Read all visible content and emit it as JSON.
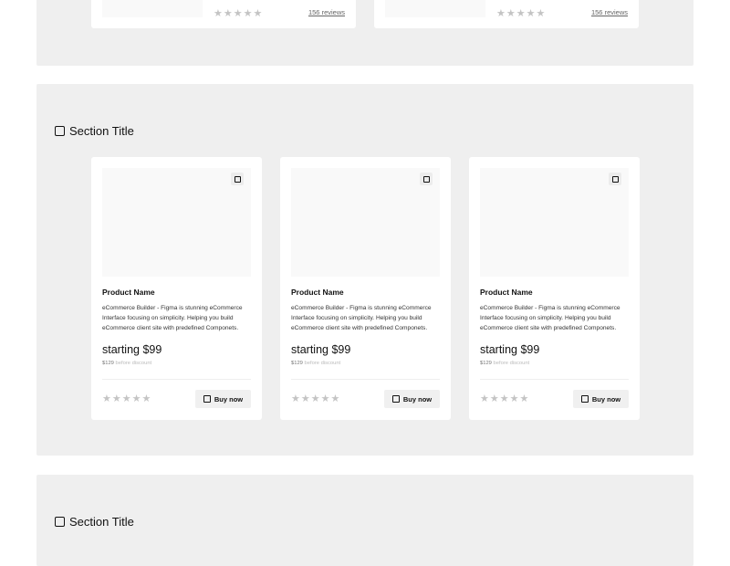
{
  "top_section": {
    "cards": [
      {
        "stars": "★★★★★",
        "reviews": "156 reviews"
      },
      {
        "stars": "★★★★★",
        "reviews": "156 reviews"
      }
    ]
  },
  "middle_section": {
    "title": "Section Title",
    "products": [
      {
        "name": "Product Name",
        "description": "eCommerce Builder - Figma is stunning eCommerce Interface focusing on simplicity. Helping you build eCommerce client site with predefined Componets.",
        "price": "starting $99",
        "old_price": "$129",
        "old_price_note": "before discount",
        "stars": "★★★★★",
        "buy_label": "Buy now"
      },
      {
        "name": "Product Name",
        "description": "eCommerce Builder - Figma is stunning eCommerce Interface focusing on simplicity. Helping you build eCommerce client site with predefined Componets.",
        "price": "starting $99",
        "old_price": "$129",
        "old_price_note": "before discount",
        "stars": "★★★★★",
        "buy_label": "Buy now"
      },
      {
        "name": "Product Name",
        "description": "eCommerce Builder - Figma is stunning eCommerce Interface focusing on simplicity. Helping you build eCommerce client site with predefined Componets.",
        "price": "starting $99",
        "old_price": "$129",
        "old_price_note": "before discount",
        "stars": "★★★★★",
        "buy_label": "Buy now"
      }
    ]
  },
  "bottom_section": {
    "title": "Section Title"
  },
  "colors": {
    "section_bg": "#efefef",
    "card_bg": "#ffffff",
    "star": "#c4c4c4"
  }
}
